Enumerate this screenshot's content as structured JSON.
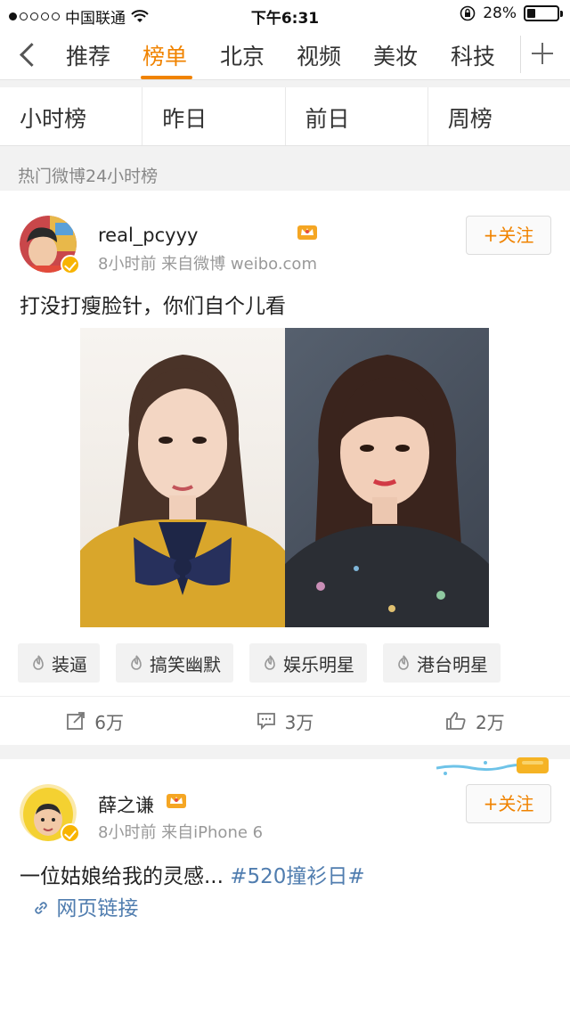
{
  "status_bar": {
    "carrier": "中国联通",
    "signal_dots": 5,
    "signal_filled": 1,
    "time": "下午6:31",
    "battery_percent": "28%",
    "battery_level": 0.28
  },
  "nav": {
    "tabs": [
      "推荐",
      "榜单",
      "北京",
      "视频",
      "美妆",
      "科技"
    ],
    "active_index": 1,
    "accent_color": "#f08300"
  },
  "subtabs": [
    "小时榜",
    "昨日",
    "前日",
    "周榜"
  ],
  "section_label": "热门微博24小时榜",
  "posts": [
    {
      "username": "real_pcyyy",
      "meta": "8小时前  来自微博 weibo.com",
      "follow_label": "+关注",
      "text": "打没打瘦脸针，你们自个儿看",
      "tags": [
        "装逼",
        "搞笑幽默",
        "娱乐明星",
        "港台明星"
      ],
      "actions": {
        "repost": "6万",
        "comment": "3万",
        "like": "2万"
      }
    },
    {
      "username": "薛之谦",
      "meta": "8小时前  来自iPhone 6",
      "follow_label": "+关注",
      "text": "一位姑娘给我的灵感...",
      "hashtag": "#520撞衫日#",
      "link_label": "网页链接"
    }
  ],
  "icons": {
    "back": "chevron-left-icon",
    "add_channel": "plus-icon",
    "verified": "verified-badge-icon",
    "member": "crown-icon",
    "tag": "flame-icon",
    "repost": "repost-icon",
    "comment": "comment-icon",
    "like": "thumbs-up-icon",
    "link": "link-icon"
  }
}
